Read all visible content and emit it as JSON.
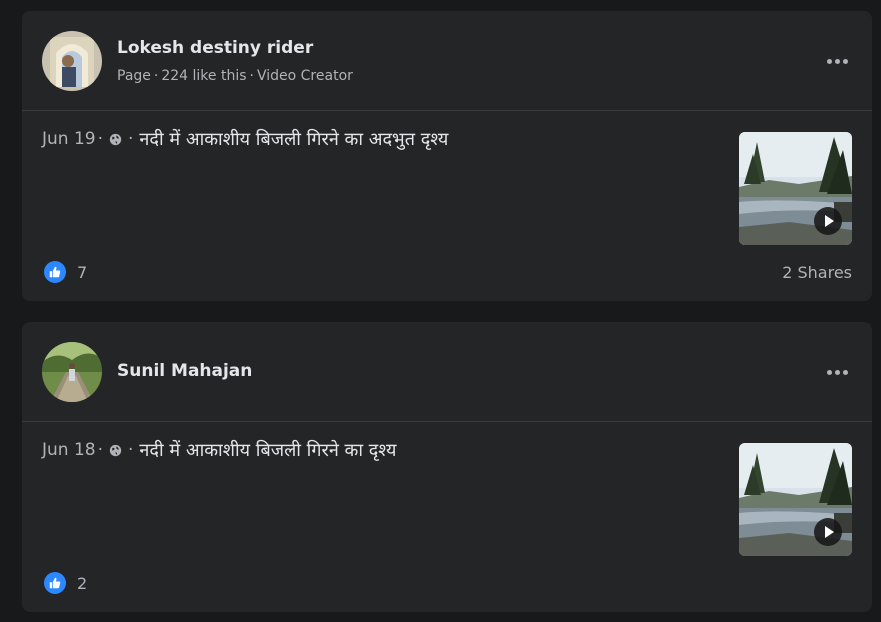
{
  "posts": [
    {
      "author": "Lokesh destiny rider",
      "subline": {
        "type": "Page",
        "likes": "224 like this",
        "category": "Video Creator"
      },
      "date": "Jun 19",
      "text": "नदी में आकाशीय बिजली गिरने का अदभुत दृश्य",
      "likes": "7",
      "shares": "2 Shares"
    },
    {
      "author": "Sunil Mahajan",
      "date": "Jun 18",
      "text": "नदी में आकाशीय बिजली गिरने का दृश्य",
      "likes": "2"
    }
  ],
  "icons": {
    "more": "more-horizontal-icon",
    "privacy": "globe-icon",
    "reaction": "like-icon",
    "media": "play-icon"
  },
  "colors": {
    "background": "#18191a",
    "card": "#242526",
    "accent": "#2d88ff",
    "text_primary": "#e4e6eb",
    "text_secondary": "#b0b3b8"
  }
}
